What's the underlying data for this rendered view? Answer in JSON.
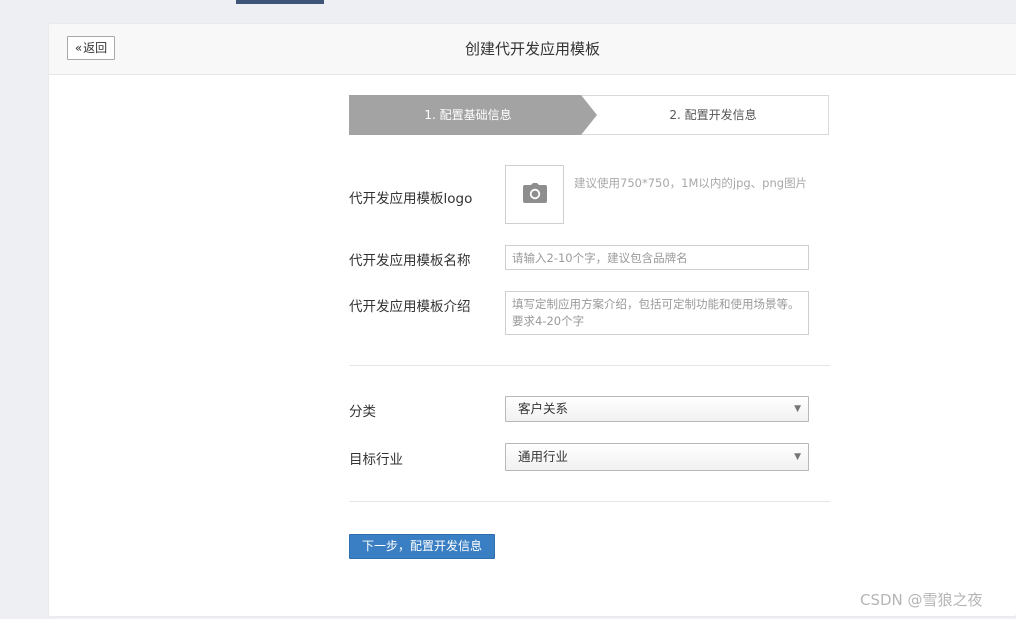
{
  "header": {
    "back_label": "返回",
    "title": "创建代开发应用模板"
  },
  "steps": [
    {
      "label": "1. 配置基础信息",
      "active": true
    },
    {
      "label": "2. 配置开发信息",
      "active": false
    }
  ],
  "form": {
    "logo_label": "代开发应用模板logo",
    "logo_hint": "建议使用750*750，1M以内的jpg、png图片",
    "name_label": "代开发应用模板名称",
    "name_placeholder": "请输入2-10个字，建议包含品牌名",
    "intro_label": "代开发应用模板介绍",
    "intro_placeholder": "填写定制应用方案介绍，包括可定制功能和使用场景等。要求4-20个字",
    "category_label": "分类",
    "category_value": "客户关系",
    "industry_label": "目标行业",
    "industry_value": "通用行业"
  },
  "actions": {
    "next_label": "下一步，配置开发信息"
  },
  "watermark": "CSDN @雪狼之夜",
  "icons": {
    "back": "double-chevron-left-icon",
    "logo_upload": "camera-icon",
    "select_arrow": "caret-down-icon"
  },
  "colors": {
    "primary_button": "#3a7fc3",
    "active_step": "#a3a3a3",
    "top_tab_indicator": "#3e5577"
  }
}
